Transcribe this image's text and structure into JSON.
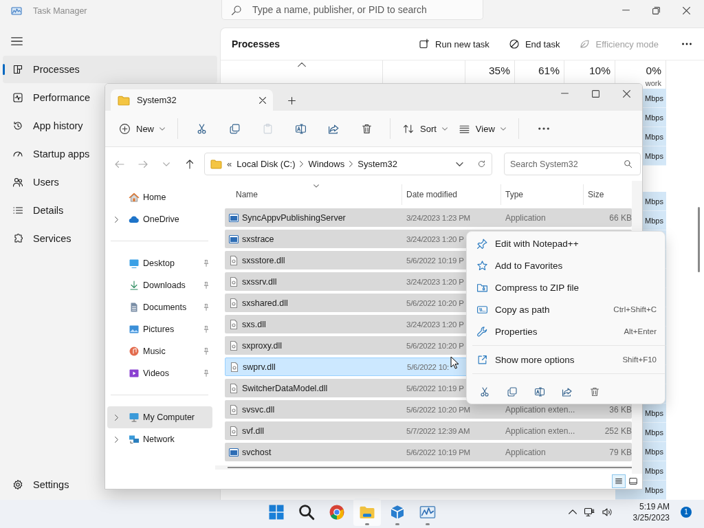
{
  "task_manager": {
    "title": "Task Manager",
    "search": {
      "placeholder": "Type a name, publisher, or PID to search"
    },
    "nav": [
      {
        "label": "Processes",
        "selected": true
      },
      {
        "label": "Performance",
        "selected": false
      },
      {
        "label": "App history",
        "selected": false
      },
      {
        "label": "Startup apps",
        "selected": false
      },
      {
        "label": "Users",
        "selected": false
      },
      {
        "label": "Details",
        "selected": false
      },
      {
        "label": "Services",
        "selected": false
      }
    ],
    "settings": {
      "label": "Settings",
      "selected": false
    },
    "page_title": "Processes",
    "actions": [
      {
        "label": "Run new task",
        "disabled": false
      },
      {
        "label": "End task",
        "disabled": false
      },
      {
        "label": "Efficiency mode",
        "disabled": true
      }
    ],
    "columns": [
      {
        "usage": "35%"
      },
      {
        "usage": "61%"
      },
      {
        "usage": "10%"
      },
      {
        "usage": "0%",
        "label": "work"
      }
    ],
    "rows": [
      {
        "kind": "row",
        "network": "Mbps"
      },
      {
        "kind": "row",
        "network": "Mbps"
      },
      {
        "kind": "row",
        "network": "Mbps"
      },
      {
        "kind": "row",
        "network": "Mbps"
      },
      {
        "kind": "group"
      },
      {
        "kind": "row",
        "network": "Mbps"
      },
      {
        "kind": "row",
        "network": "Mbps"
      },
      {
        "kind": "row"
      },
      {
        "kind": "row"
      },
      {
        "kind": "row"
      },
      {
        "kind": "row"
      },
      {
        "kind": "row"
      },
      {
        "kind": "row"
      },
      {
        "kind": "row"
      },
      {
        "kind": "row"
      },
      {
        "kind": "row"
      },
      {
        "kind": "row",
        "network": "Mbps"
      },
      {
        "kind": "row",
        "network": "Mbps"
      },
      {
        "kind": "row",
        "network": "Mbps"
      },
      {
        "kind": "row",
        "network": "Mbps"
      },
      {
        "kind": "row",
        "network": "Mbps"
      }
    ]
  },
  "explorer": {
    "tab": {
      "title": "System32"
    },
    "toolbar": [
      {
        "kind": "button",
        "label": "New",
        "disabled": false
      },
      {
        "kind": "separator"
      },
      {
        "kind": "button",
        "disabled": false
      },
      {
        "kind": "button",
        "disabled": false
      },
      {
        "kind": "button",
        "disabled": true
      },
      {
        "kind": "button",
        "disabled": false
      },
      {
        "kind": "button",
        "disabled": false
      },
      {
        "kind": "button",
        "disabled": false
      },
      {
        "kind": "separator"
      },
      {
        "kind": "button",
        "label": "Sort",
        "disabled": false
      },
      {
        "kind": "button",
        "label": "View",
        "disabled": false
      },
      {
        "kind": "separator"
      },
      {
        "kind": "button",
        "disabled": false
      }
    ],
    "nav_buttons": [
      {
        "disabled": true
      },
      {
        "disabled": true
      },
      {
        "disabled": true
      },
      {
        "disabled": false
      }
    ],
    "address": {
      "overflow": "«",
      "segments": [
        "Local Disk (C:)",
        "Windows",
        "System32"
      ]
    },
    "search": {
      "placeholder": "Search System32"
    },
    "nav_pane": [
      {
        "kind": "item",
        "label": "Home",
        "expandable": false,
        "pinned": false,
        "selected": false
      },
      {
        "kind": "item",
        "label": "OneDrive",
        "expandable": true,
        "pinned": false,
        "selected": false
      },
      {
        "kind": "divider"
      },
      {
        "kind": "item",
        "label": "Desktop",
        "expandable": false,
        "pinned": true,
        "selected": false
      },
      {
        "kind": "item",
        "label": "Downloads",
        "expandable": false,
        "pinned": true,
        "selected": false
      },
      {
        "kind": "item",
        "label": "Documents",
        "expandable": false,
        "pinned": true,
        "selected": false
      },
      {
        "kind": "item",
        "label": "Pictures",
        "expandable": false,
        "pinned": true,
        "selected": false
      },
      {
        "kind": "item",
        "label": "Music",
        "expandable": false,
        "pinned": true,
        "selected": false
      },
      {
        "kind": "item",
        "label": "Videos",
        "expandable": false,
        "pinned": true,
        "selected": false
      },
      {
        "kind": "divider"
      },
      {
        "kind": "item",
        "label": "My Computer",
        "expandable": true,
        "pinned": false,
        "selected": true
      },
      {
        "kind": "item",
        "label": "Network",
        "expandable": true,
        "pinned": false,
        "selected": false
      }
    ],
    "columns": [
      "Name",
      "Date modified",
      "Type",
      "Size"
    ],
    "files": [
      {
        "name": "SyncAppvPublishingServer",
        "kind": "app",
        "date": "3/24/2023 1:23 PM",
        "type": "Application",
        "size": "66 KB",
        "selected": true,
        "hovered": false
      },
      {
        "name": "sxstrace",
        "kind": "app",
        "date": "3/24/2023 1:20 P",
        "selected": true,
        "hovered": false
      },
      {
        "name": "sxsstore.dll",
        "kind": "dll",
        "date": "5/6/2022 10:19 P",
        "selected": true,
        "hovered": false
      },
      {
        "name": "sxssrv.dll",
        "kind": "dll",
        "date": "3/24/2023 1:20 P",
        "selected": true,
        "hovered": false
      },
      {
        "name": "sxshared.dll",
        "kind": "dll",
        "date": "5/6/2022 10:20 P",
        "selected": true,
        "hovered": false
      },
      {
        "name": "sxs.dll",
        "kind": "dll",
        "date": "3/24/2023 1:20 P",
        "selected": true,
        "hovered": false
      },
      {
        "name": "sxproxy.dll",
        "kind": "dll",
        "date": "5/6/2022 10:20 P",
        "selected": true,
        "hovered": false
      },
      {
        "name": "swprv.dll",
        "kind": "dll",
        "date": "5/6/2022 10:",
        "selected": true,
        "hovered": true
      },
      {
        "name": "SwitcherDataModel.dll",
        "kind": "dll",
        "date": "5/6/2022 10:19 P",
        "selected": true,
        "hovered": false
      },
      {
        "name": "svsvc.dll",
        "kind": "dll",
        "date": "5/6/2022 10:20 PM",
        "type": "Application exten...",
        "size": "36 KB",
        "selected": true,
        "hovered": false
      },
      {
        "name": "svf.dll",
        "kind": "dll",
        "date": "5/7/2022 12:39 AM",
        "type": "Application exten...",
        "size": "252 KB",
        "selected": true,
        "hovered": false
      },
      {
        "name": "svchost",
        "kind": "app",
        "date": "5/6/2022 10:19 PM",
        "type": "Application",
        "size": "79 KB",
        "selected": true,
        "hovered": false
      }
    ],
    "views": [
      {
        "selected": true
      },
      {
        "selected": false
      }
    ]
  },
  "context_menu": {
    "items": [
      {
        "kind": "item",
        "label": "Edit with Notepad++"
      },
      {
        "kind": "item",
        "label": "Add to Favorites"
      },
      {
        "kind": "item",
        "label": "Compress to ZIP file"
      },
      {
        "kind": "item",
        "label": "Copy as path",
        "shortcut": "Ctrl+Shift+C"
      },
      {
        "kind": "item",
        "label": "Properties",
        "shortcut": "Alt+Enter"
      },
      {
        "kind": "divider"
      },
      {
        "kind": "item",
        "label": "Show more options",
        "shortcut": "Shift+F10"
      },
      {
        "kind": "divider"
      }
    ]
  },
  "taskbar": {
    "apps": [
      {
        "active": false,
        "running": false
      },
      {
        "active": false,
        "running": false
      },
      {
        "active": false,
        "running": false
      },
      {
        "active": true,
        "running": true
      },
      {
        "active": false,
        "running": true
      },
      {
        "active": false,
        "running": true
      }
    ],
    "time": "5:19 AM",
    "date": "3/25/2023",
    "badge": "1"
  }
}
